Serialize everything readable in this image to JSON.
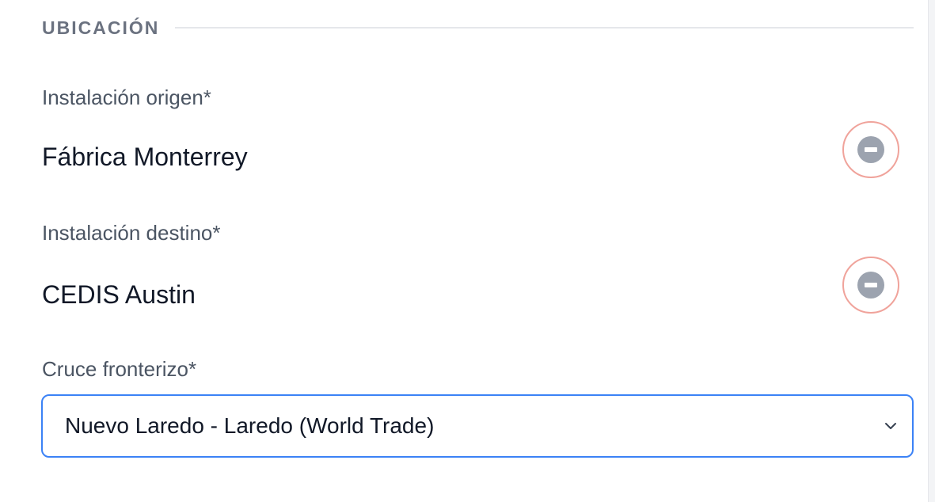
{
  "section": {
    "title": "UBICACIÓN"
  },
  "origin": {
    "label": "Instalación origen*",
    "value": "Fábrica Monterrey",
    "remove_icon": "minus-circle-icon"
  },
  "destination": {
    "label": "Instalación destino*",
    "value": "CEDIS Austin",
    "remove_icon": "minus-circle-icon"
  },
  "border_crossing": {
    "label": "Cruce fronterizo*",
    "selected": "Nuevo Laredo - Laredo (World Trade)",
    "dropdown_icon": "chevron-down-icon"
  },
  "colors": {
    "accent": "#3b82f6",
    "remove_border": "#f0a39b",
    "remove_icon": "#9ca3af"
  }
}
